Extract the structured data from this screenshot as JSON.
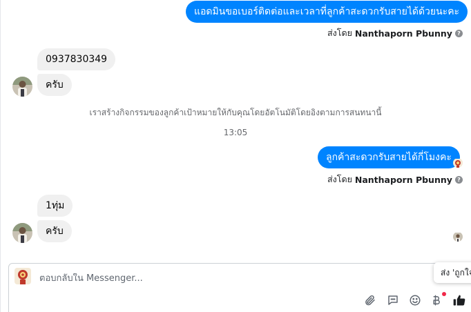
{
  "messages": {
    "out_1": "แอดมินขอเบอร์ติดต่อและเวลาที่ลูกค้าสะดวกรับสายได้ด้วยนะคะ",
    "in_1": "0937830349",
    "in_2": "ครับ",
    "out_2": "ลูกค้าสะดวกรับสายได้กี่โมงคะ",
    "in_3": "1ทุ่ม",
    "in_4": "ครับ"
  },
  "sender_1": {
    "prefix": "ส่งโดย",
    "name": "Nanthaporn Pbunny",
    "help": "?"
  },
  "sender_2": {
    "prefix": "ส่งโดย",
    "name": "Nanthaporn Pbunny",
    "help": "?"
  },
  "system_note": "เราสร้างกิจกรรมของลูกค้าเป้าหมายให้กับคุณโดยอัตโนมัติโดยอิงตามการสนทนานี้",
  "timestamp": "13:05",
  "composer": {
    "placeholder": "ตอบกลับใน Messenger...",
    "tooltip": "ส่ง 'ถูกใจ'"
  },
  "icons": [
    "attachment-icon",
    "saved-replies-icon",
    "emoji-icon",
    "payment-icon",
    "like-icon",
    "help-icon"
  ],
  "colors": {
    "outgoing_bubble": "#0084ff",
    "incoming_bubble": "#f0f0f0",
    "like_button": "#1c1e21",
    "notification": "#f02849"
  }
}
